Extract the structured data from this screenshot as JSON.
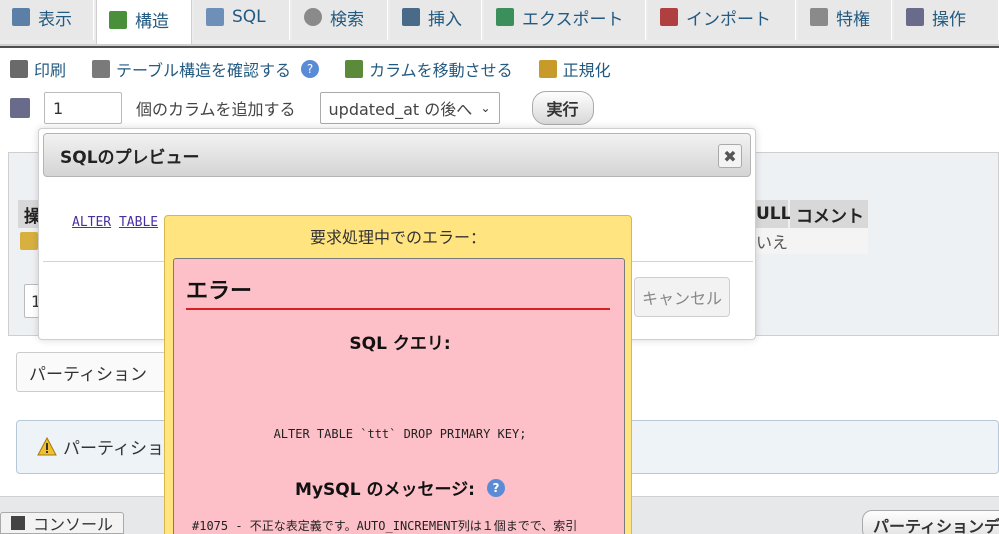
{
  "tabs": [
    {
      "label": "表示",
      "icon": "table-icon",
      "color": "#5b7fa6"
    },
    {
      "label": "構造",
      "icon": "structure-icon",
      "color": "#4a8f3a",
      "active": true
    },
    {
      "label": "SQL",
      "icon": "sql-icon",
      "color": "#6e8fb8"
    },
    {
      "label": "検索",
      "icon": "search-icon",
      "color": "#7a7a7a"
    },
    {
      "label": "挿入",
      "icon": "insert-icon",
      "color": "#4a6a8a"
    },
    {
      "label": "エクスポート",
      "icon": "export-icon",
      "color": "#3a8f5a"
    },
    {
      "label": "インポート",
      "icon": "import-icon",
      "color": "#b04040"
    },
    {
      "label": "特権",
      "icon": "privileges-icon",
      "color": "#8a8a8a"
    },
    {
      "label": "操作",
      "icon": "wrench-icon",
      "color": "#6a6a8a"
    }
  ],
  "actions": [
    {
      "label": "印刷",
      "icon": "print-icon"
    },
    {
      "label": "テーブル構造を確認する",
      "icon": "table-structure-icon"
    },
    {
      "label": "カラムを移動させる",
      "icon": "move-columns-icon"
    },
    {
      "label": "正規化",
      "icon": "normalize-icon"
    }
  ],
  "add_columns": {
    "count": "1",
    "label": "個のカラムを追加する",
    "position_selected": "updated_at の後へ",
    "execute": "実行"
  },
  "background": {
    "header_cols": [
      "操",
      "ULL",
      "コメント"
    ],
    "row_cells": [
      "いえ"
    ],
    "partition_title": "パーティション",
    "partition_note": "パーティショ",
    "console": "コンソール",
    "partition_button": "パーティションデ"
  },
  "dialog": {
    "title": "SQLのプレビュー",
    "close": "✖",
    "sql_kw1": "ALTER",
    "sql_kw2": "TABLE",
    "sql_tail": "`",
    "cancel": "キャンセル"
  },
  "error": {
    "header": "要求処理中でのエラー：",
    "title": "エラー",
    "sql_heading": "SQL クエリ:",
    "query": "ALTER TABLE `ttt` DROP PRIMARY KEY;",
    "message_heading": "MySQL のメッセージ:",
    "help": "?",
    "message": "#1075 - 不正な表定義です。AUTO_INCREMENT列は１個までで、索引"
  },
  "colors": {
    "link": "#235a81",
    "error_pink": "#fdc0c8",
    "error_yellow": "#ffe480",
    "error_rule": "#d92020"
  }
}
